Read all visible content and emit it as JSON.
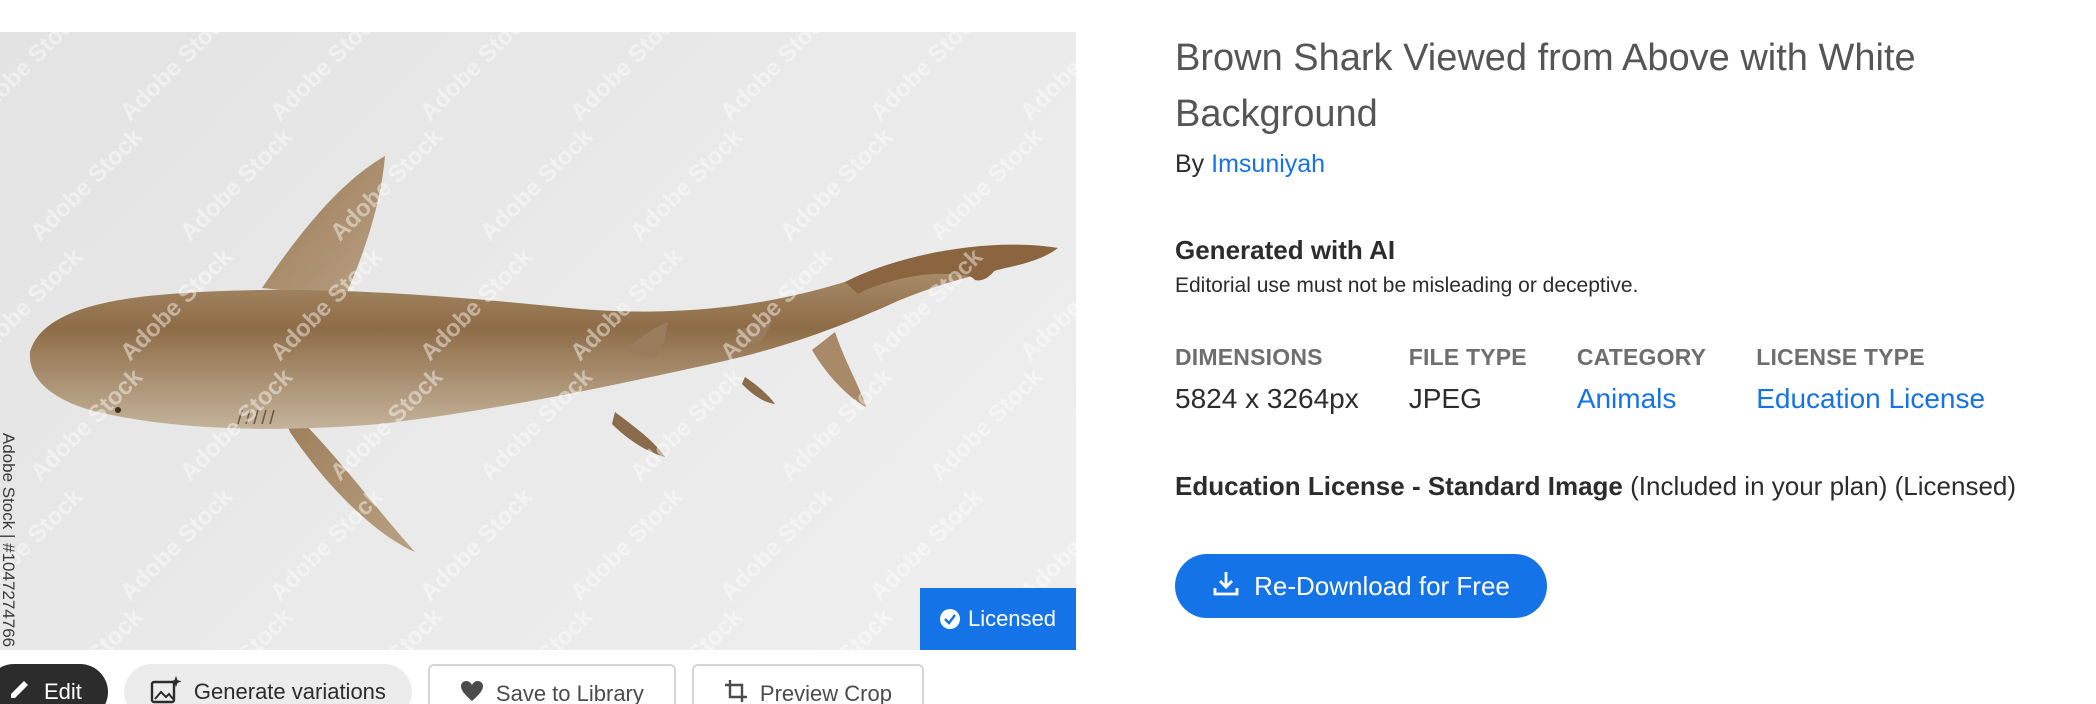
{
  "image": {
    "watermark_text": "Adobe Stock",
    "side_credit": "Adobe Stock | #1047274766",
    "licensed_badge": "Licensed"
  },
  "actions": {
    "edit": "Edit",
    "generate": "Generate variations",
    "save": "Save to Library",
    "preview": "Preview Crop"
  },
  "asset": {
    "title": "Brown Shark Viewed from Above with White Background",
    "by_prefix": "By",
    "author": "Imsuniyah"
  },
  "ai": {
    "title": "Generated with AI",
    "note": "Editorial use must not be misleading or deceptive."
  },
  "meta": {
    "dimensions_label": "DIMENSIONS",
    "dimensions_value": "5824 x 3264px",
    "filetype_label": "FILE TYPE",
    "filetype_value": "JPEG",
    "category_label": "CATEGORY",
    "category_value": "Animals",
    "license_label": "LICENSE TYPE",
    "license_value": "Education License"
  },
  "license_line": {
    "strong": "Education License - Standard Image",
    "included": "(Included in your plan)",
    "status": "(Licensed)"
  },
  "download": {
    "label": "Re-Download for Free"
  },
  "colors": {
    "accent": "#1473e6",
    "dark_button": "#2c2c2c"
  },
  "icons": {
    "edit": "pencil-icon",
    "generate": "sparkle-image-icon",
    "save": "heart-icon",
    "preview": "crop-icon",
    "download": "download-icon",
    "badge": "check-circle-icon"
  }
}
